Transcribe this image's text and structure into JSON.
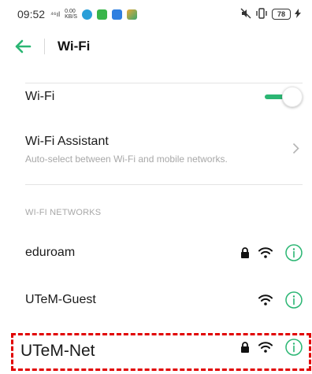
{
  "status_bar": {
    "time": "09:52",
    "signal": "⁴⁶ıl",
    "net_speed_value": "0.00",
    "net_speed_unit": "KB/S",
    "battery": "78"
  },
  "header": {
    "title": "Wi-Fi"
  },
  "wifi_toggle": {
    "label": "Wi-Fi",
    "enabled": true
  },
  "assistant": {
    "title": "Wi-Fi Assistant",
    "subtitle": "Auto-select between Wi-Fi and mobile networks."
  },
  "networks_header": "WI-FI NETWORKS",
  "networks": [
    {
      "name": "eduroam",
      "secured": true
    },
    {
      "name": "UTeM-Guest",
      "secured": false
    },
    {
      "name": "UTeM-Net",
      "secured": true
    }
  ],
  "colors": {
    "accent": "#2bb673",
    "highlight": "#e10000"
  }
}
